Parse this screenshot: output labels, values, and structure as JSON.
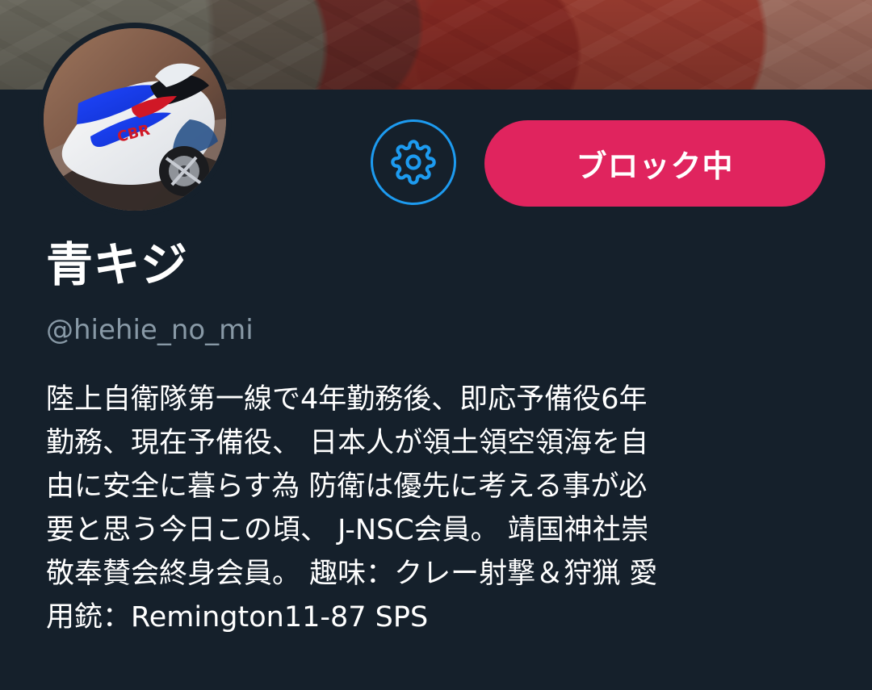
{
  "banner": {
    "name": "profile-banner"
  },
  "avatar": {
    "name": "profile-avatar"
  },
  "actions": {
    "settings_icon": "gear-icon",
    "blocked_label": "ブロック中"
  },
  "profile": {
    "display_name": "青キジ",
    "username": "@hiehie_no_mi",
    "bio_lines": [
      "陸上自衛隊第一線で4年勤務後、即応予備役6年",
      "勤務、現在予備役、 日本人が領土領空領海を自",
      "由に安全に暮らす為 防衛は優先に考える事が必",
      "要と思う今日この頃、 J-NSC会員。 靖国神社崇",
      "敬奉賛会終身会員。 趣味：クレー射撃＆狩猟 愛",
      "用銃：Remington11-87 SPS"
    ]
  },
  "colors": {
    "background": "#15202b",
    "accent": "#1d9bf0",
    "blocked": "#e0245e",
    "secondary_text": "#8899a6"
  }
}
